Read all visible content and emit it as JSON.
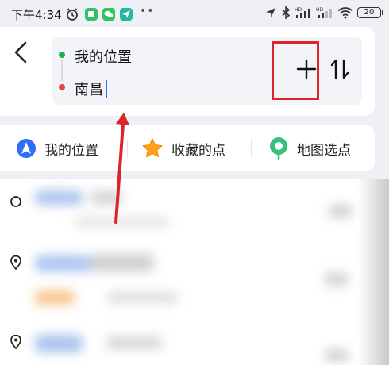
{
  "status_bar": {
    "time": "下午4:34",
    "battery": "20"
  },
  "route": {
    "start_text": "我的位置",
    "end_text": "南昌"
  },
  "quick_bar": {
    "items": [
      {
        "label": "我的位置",
        "icon": "location-arrow-icon"
      },
      {
        "label": "收藏的点",
        "icon": "star-icon"
      },
      {
        "label": "地图选点",
        "icon": "map-pin-icon"
      }
    ]
  },
  "colors": {
    "accent": "#2f6ff5",
    "start_dot": "#1ab05a",
    "end_dot": "#e64545",
    "annotation_red": "#d9252b"
  }
}
